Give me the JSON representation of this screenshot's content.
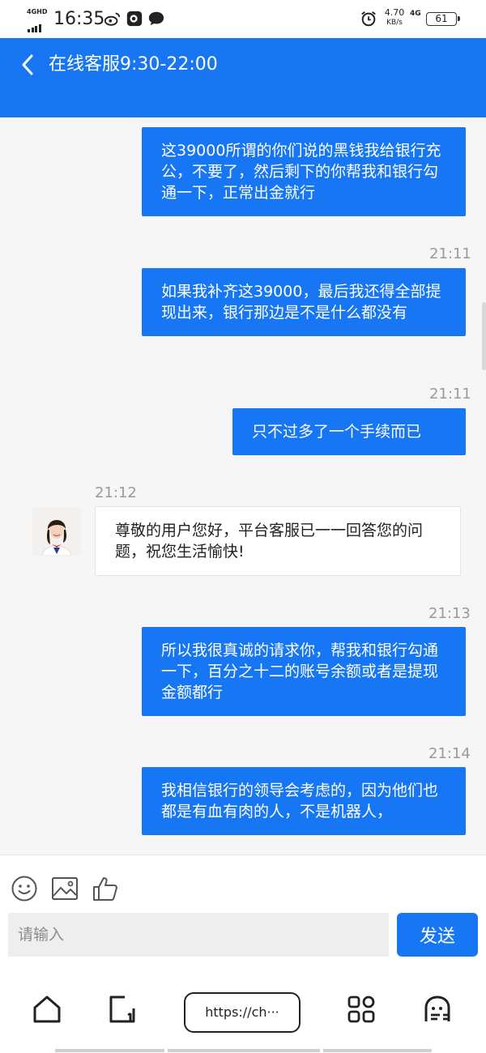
{
  "status_bar": {
    "network": "4GHD",
    "time": "16:35",
    "net_speed": "4.70",
    "net_speed_unit": "KB/s",
    "network_right": "4G",
    "battery": "61",
    "icons": [
      "weibo-icon",
      "app-icon",
      "chat-bubble-icon",
      "alarm-icon"
    ]
  },
  "header": {
    "title": "在线客服9:30-22:00",
    "back_icon": "chevron-left-icon"
  },
  "messages": [
    {
      "side": "out",
      "time": "",
      "text": "这39000所谓的你们说的黑钱我给银行充公，不要了，然后剩下的你帮我和银行勾通一下，正常出金就行"
    },
    {
      "side": "out",
      "time": "21:11",
      "text": "如果我补齐这39000，最后我还得全部提现出来，银行那边是不是什么都没有"
    },
    {
      "side": "out",
      "time": "21:11",
      "text": "只不过多了一个手续而已"
    },
    {
      "side": "in",
      "time": "21:12",
      "text": "尊敬的用户您好，平台客服已一一回答您的问题，祝您生活愉快!"
    },
    {
      "side": "out",
      "time": "21:13",
      "text": "所以我很真诚的请求你，帮我和银行勾通一下，百分之十二的账号余额或者是提现金额都行"
    },
    {
      "side": "out",
      "time": "21:14",
      "text": "我相信银行的领导会考虑的，因为他们也都是有血有肉的人，不是机器人，"
    }
  ],
  "composer": {
    "placeholder": "请输入",
    "send_label": "发送",
    "tools": [
      "emoji-icon",
      "image-icon",
      "thumbs-up-icon"
    ]
  },
  "browser_nav": {
    "url": "https://ch···",
    "icons": [
      "home-icon",
      "tabs-icon",
      "apps-grid-icon",
      "ghost-icon"
    ]
  },
  "colors": {
    "accent": "#1676f3",
    "header": "#1976f2",
    "background": "#f6f6f6"
  }
}
